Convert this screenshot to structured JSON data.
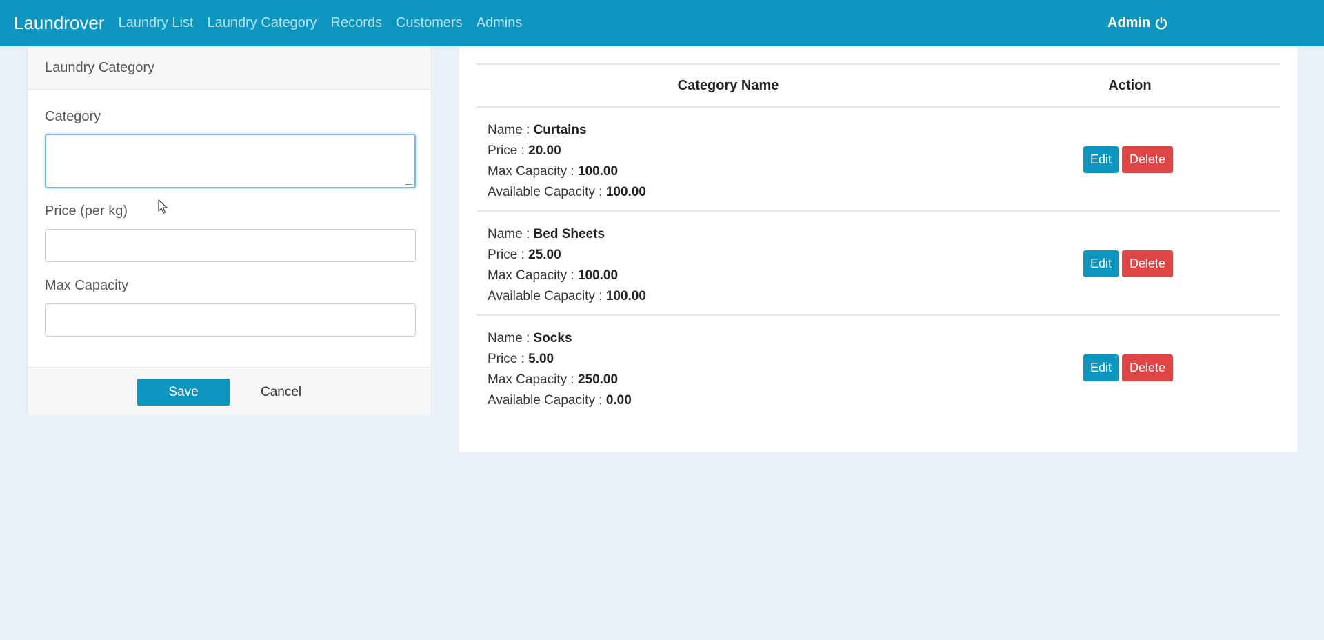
{
  "navbar": {
    "brand": "Laundrover",
    "links": [
      "Laundry List",
      "Laundry Category",
      "Records",
      "Customers",
      "Admins"
    ],
    "user": "Admin",
    "user_icon": "power-icon"
  },
  "form": {
    "title": "Laundry Category",
    "category_label": "Category",
    "category_value": "",
    "price_label": "Price (per kg)",
    "price_value": "",
    "max_capacity_label": "Max Capacity",
    "max_capacity_value": "",
    "save_label": "Save",
    "cancel_label": "Cancel"
  },
  "table": {
    "headers": {
      "name": "Category Name",
      "action": "Action"
    },
    "labels": {
      "name": "Name : ",
      "price": "Price : ",
      "max": "Max Capacity : ",
      "available": "Available Capacity : "
    },
    "rows": [
      {
        "name": "Curtains",
        "price": "20.00",
        "max_capacity": "100.00",
        "available_capacity": "100.00"
      },
      {
        "name": "Bed Sheets",
        "price": "25.00",
        "max_capacity": "100.00",
        "available_capacity": "100.00"
      },
      {
        "name": "Socks",
        "price": "5.00",
        "max_capacity": "250.00",
        "available_capacity": "0.00"
      }
    ],
    "edit_label": "Edit",
    "delete_label": "Delete"
  },
  "colors": {
    "navbar": "#0b95bf",
    "primary_button": "#0b95bf",
    "danger_button": "#e04545",
    "background": "#e9f0f8"
  }
}
